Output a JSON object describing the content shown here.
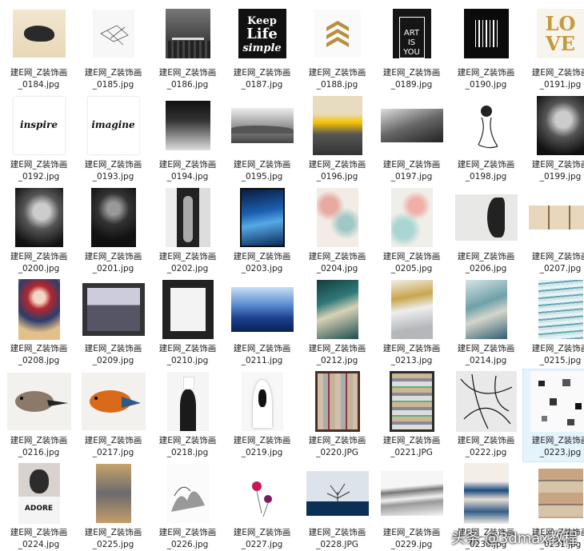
{
  "files": [
    {
      "line1": "建E网_Z装饰画",
      "line2": "_0184.jpg",
      "art": "stone"
    },
    {
      "line1": "建E网_Z装饰画",
      "line2": "_0185.jpg",
      "art": "sketch"
    },
    {
      "line1": "建E网_Z装饰画",
      "line2": "_0186.jpg",
      "art": "pier"
    },
    {
      "line1": "建E网_Z装饰画",
      "line2": "_0187.jpg",
      "art": "keep-life",
      "text": [
        "Keep",
        "Life",
        "simple"
      ]
    },
    {
      "line1": "建E网_Z装饰画",
      "line2": "_0188.jpg",
      "art": "chevrons"
    },
    {
      "line1": "建E网_Z装饰画",
      "line2": "_0189.jpg",
      "art": "art-is-you",
      "text": [
        "ART",
        "IS",
        "YOU"
      ]
    },
    {
      "line1": "建E网_Z装饰画",
      "line2": "_0190.jpg",
      "art": "barcode"
    },
    {
      "line1": "建E网_Z装饰画",
      "line2": "_0191.jpg",
      "art": "love",
      "text": [
        "LO",
        "VE"
      ]
    },
    {
      "line1": "建E网_Z装饰画",
      "line2": "_0192.jpg",
      "art": "word",
      "text": [
        "inspire"
      ]
    },
    {
      "line1": "建E网_Z装饰画",
      "line2": "_0193.jpg",
      "art": "word",
      "text": [
        "imagine"
      ]
    },
    {
      "line1": "建E网_Z装饰画",
      "line2": "_0194.jpg",
      "art": "gray-blocks"
    },
    {
      "line1": "建E网_Z装饰画",
      "line2": "_0195.jpg",
      "art": "misty"
    },
    {
      "line1": "建E网_Z装饰画",
      "line2": "_0196.jpg",
      "art": "sunset"
    },
    {
      "line1": "建E网_Z装饰画",
      "line2": "_0197.jpg",
      "art": "clouds"
    },
    {
      "line1": "建E网_Z装饰画",
      "line2": "_0198.jpg",
      "art": "fashion"
    },
    {
      "line1": "建E网_Z装饰画",
      "line2": "_0199.jpg",
      "art": "portrait-bw"
    },
    {
      "line1": "建E网_Z装饰画",
      "line2": "_0200.jpg",
      "art": "portrait-bw"
    },
    {
      "line1": "建E网_Z装饰画",
      "line2": "_0201.jpg",
      "art": "portrait-dark"
    },
    {
      "line1": "建E网_Z装饰画",
      "line2": "_0202.jpg",
      "art": "portrait-door"
    },
    {
      "line1": "建E网_Z装饰画",
      "line2": "_0203.jpg",
      "art": "blue-abstract"
    },
    {
      "line1": "建E网_Z装饰画",
      "line2": "_0204.jpg",
      "art": "pastel-red"
    },
    {
      "line1": "建E网_Z装饰画",
      "line2": "_0205.jpg",
      "art": "pastel-teal"
    },
    {
      "line1": "建E网_Z装饰画",
      "line2": "_0206.jpg",
      "art": "face-profile"
    },
    {
      "line1": "建E网_Z装饰画",
      "line2": "_0207.jpg",
      "art": "botanical"
    },
    {
      "line1": "建E网_Z装饰画",
      "line2": "_0208.jpg",
      "art": "opera"
    },
    {
      "line1": "建E网_Z装饰画",
      "line2": "_0209.jpg",
      "art": "group-photo"
    },
    {
      "line1": "建E网_Z装饰画",
      "line2": "_0210.jpg",
      "art": "framed-white"
    },
    {
      "line1": "建E网_Z装饰画",
      "line2": "_0211.jpg",
      "art": "blue-mountains"
    },
    {
      "line1": "建E网_Z装饰画",
      "line2": "_0212.jpg",
      "art": "teal-abstract"
    },
    {
      "line1": "建E网_Z装饰画",
      "line2": "_0213.jpg",
      "art": "gold-abstract"
    },
    {
      "line1": "建E网_Z装饰画",
      "line2": "_0214.jpg",
      "art": "blue-brush"
    },
    {
      "line1": "建E网_Z装饰画",
      "line2": "_0215.jpg",
      "art": "sea-texture"
    },
    {
      "line1": "建E网_Z装饰画",
      "line2": "_0216.jpg",
      "art": "bird-gray"
    },
    {
      "line1": "建E网_Z装饰画",
      "line2": "_0217.jpg",
      "art": "bird-orange"
    },
    {
      "line1": "建E网_Z装饰画",
      "line2": "_0218.jpg",
      "art": "african-woman"
    },
    {
      "line1": "建E网_Z装饰画",
      "line2": "_0219.jpg",
      "art": "hooded"
    },
    {
      "line1": "建E网_Z装饰画",
      "line2": "_0220.JPG",
      "art": "mosaic"
    },
    {
      "line1": "建E网_Z装饰画",
      "line2": "_0221.JPG",
      "art": "mosaic2"
    },
    {
      "line1": "建E网_Z装饰画",
      "line2": "_0222.jpg",
      "art": "splatter"
    },
    {
      "line1": "建E网_Z装饰画",
      "line2": "_0223.jpg",
      "art": "dots",
      "selected": true
    },
    {
      "line1": "建E网_Z装饰画",
      "line2": "_0224.jpg",
      "art": "girl-adore",
      "text": [
        "ADORE"
      ]
    },
    {
      "line1": "建E网_Z装饰画",
      "line2": "_0225.jpg",
      "art": "vintage"
    },
    {
      "line1": "建E网_Z装饰画",
      "line2": "_0226.jpg",
      "art": "ink-landscape"
    },
    {
      "line1": "建E网_Z装饰画",
      "line2": "_0227.jpg",
      "art": "flowers"
    },
    {
      "line1": "建E网_Z装饰画",
      "line2": "_0228.JPG",
      "art": "tree"
    },
    {
      "line1": "建E网_Z装饰画",
      "line2": "_0229.jpg",
      "art": "ink-wash"
    },
    {
      "line1": "建E网_Z装饰画",
      "line2": "_0230.jpg",
      "art": "blue-paint"
    },
    {
      "line1": "建E网_Z装饰画",
      "line2": "_0231.jpg",
      "art": "vintage-photos"
    }
  ],
  "watermark": "头条 @3dmax教程"
}
